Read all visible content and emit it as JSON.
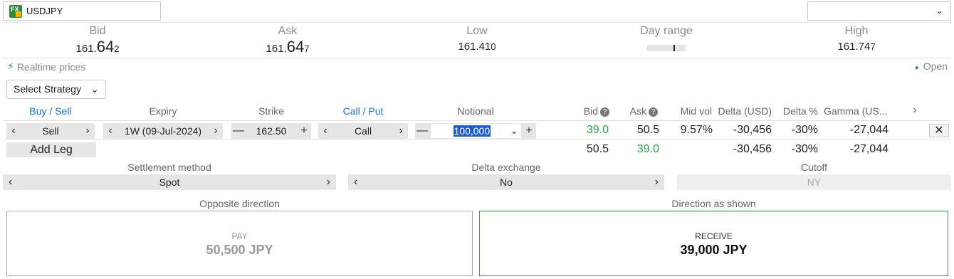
{
  "symbol": "USDJPY",
  "symbol_icon": "fx-icon",
  "quotes": {
    "bid": {
      "label": "Bid",
      "prefix": "161.",
      "big": "64",
      "small": "2"
    },
    "ask": {
      "label": "Ask",
      "prefix": "161.",
      "big": "64",
      "small": "7"
    },
    "low": {
      "label": "Low",
      "main": "161.41",
      "small": "0"
    },
    "day_range": {
      "label": "Day range"
    },
    "high": {
      "label": "High",
      "main": "161.74",
      "small": "7"
    }
  },
  "realtime": "Realtime prices",
  "market_status": "Open",
  "strategy": "Select Strategy",
  "headers": {
    "buy_sell": "Buy / Sell",
    "expiry": "Expiry",
    "strike": "Strike",
    "call_put": "Call / Put",
    "notional": "Notional",
    "bid": "Bid",
    "ask": "Ask",
    "mid_vol": "Mid vol",
    "delta_usd": "Delta (USD)",
    "delta_pct": "Delta %",
    "gamma": "Gamma (US..."
  },
  "leg": {
    "side": "Sell",
    "expiry": "1W (09-Jul-2024)",
    "strike": "162.50",
    "type": "Call",
    "notional": "100,000",
    "bid": "39.0",
    "ask": "50.5",
    "mid_vol": "9.57%",
    "delta_usd": "-30,456",
    "delta_pct": "-30%",
    "gamma": "-27,044"
  },
  "total": {
    "bid": "50.5",
    "ask": "39.0",
    "delta_usd": "-30,456",
    "delta_pct": "-30%",
    "gamma": "-27,044"
  },
  "add_leg": "Add Leg",
  "settlement": {
    "label": "Settlement method",
    "value": "Spot"
  },
  "delta_exchange": {
    "label": "Delta exchange",
    "value": "No"
  },
  "cutoff": {
    "label": "Cutoff",
    "value": "NY"
  },
  "opposite": {
    "label": "Opposite direction",
    "action": "PAY",
    "amount": "50,500 JPY"
  },
  "shown": {
    "label": "Direction as shown",
    "action": "RECEIVE",
    "amount": "39,000 JPY"
  },
  "colors": {
    "accent_green": "#2f9e44",
    "link_blue": "#1e6fd9"
  }
}
